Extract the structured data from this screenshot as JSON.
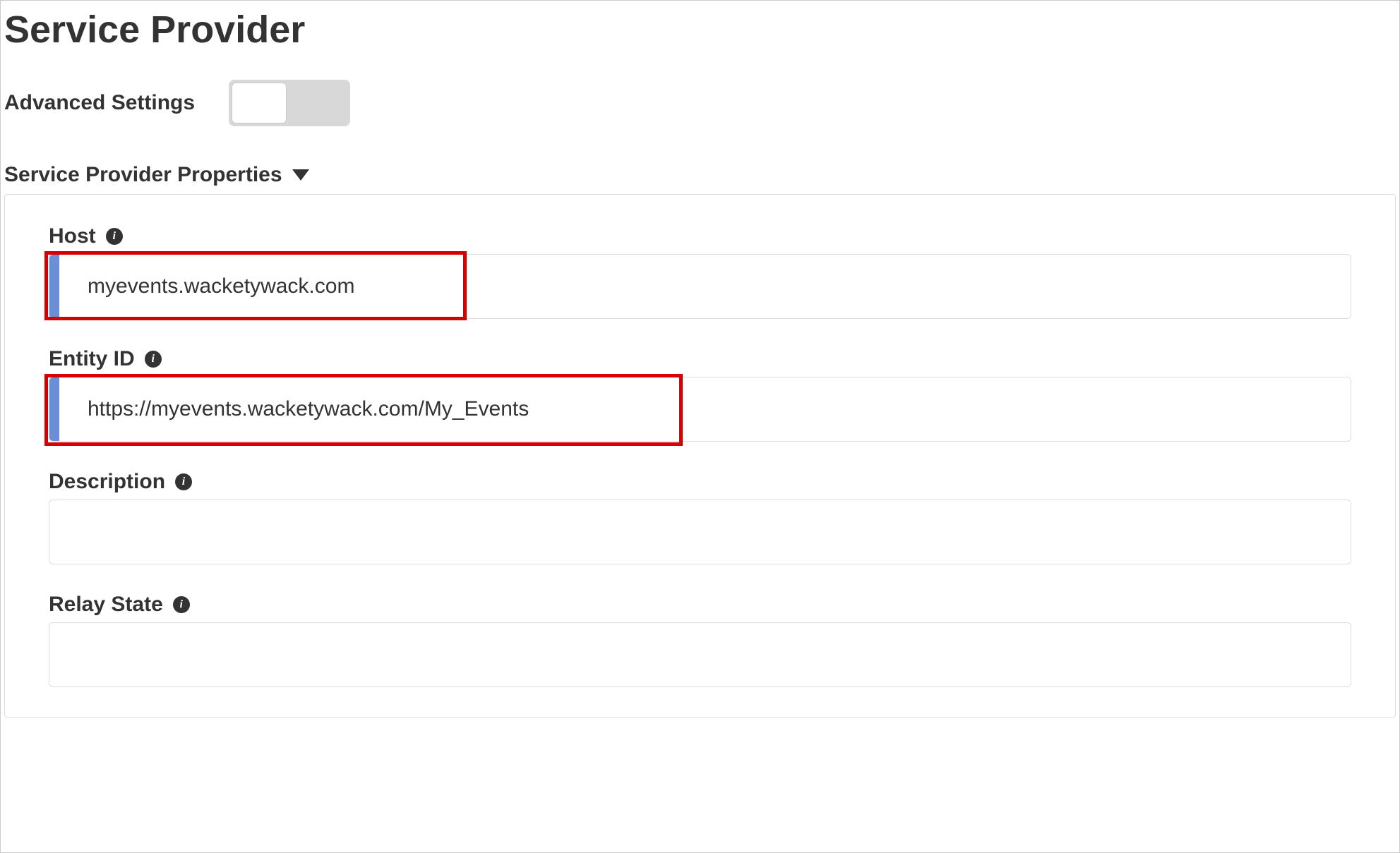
{
  "page": {
    "title": "Service Provider"
  },
  "advanced": {
    "label": "Advanced Settings",
    "enabled": false
  },
  "section": {
    "title": "Service Provider Properties"
  },
  "fields": {
    "host": {
      "label": "Host",
      "value": "myevents.wacketywack.com"
    },
    "entity_id": {
      "label": "Entity ID",
      "value": "https://myevents.wacketywack.com/My_Events"
    },
    "description": {
      "label": "Description",
      "value": ""
    },
    "relay_state": {
      "label": "Relay State",
      "value": ""
    }
  }
}
